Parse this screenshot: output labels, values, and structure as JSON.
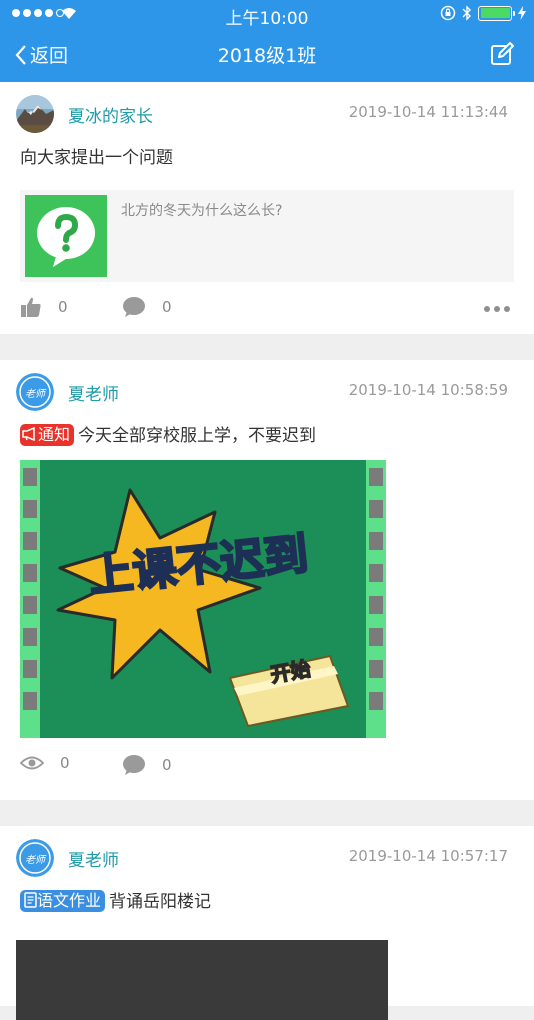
{
  "status_bar": {
    "time": "上午10:00"
  },
  "nav": {
    "back_label": "返回",
    "title": "2018级1班"
  },
  "posts": [
    {
      "author": "夏冰的家长",
      "date": "2019-10-14 11:13:44",
      "text": "向大家提出一个问题",
      "link_text": "北方的冬天为什么这么长?",
      "likes": "0",
      "comments": "0"
    },
    {
      "author": "夏老师",
      "date": "2019-10-14 10:58:59",
      "badge": "通知",
      "text": "今天全部穿校服上学，不要迟到",
      "image_title": "上课不迟到",
      "image_caption": "开始",
      "views": "0",
      "comments": "0"
    },
    {
      "author": "夏老师",
      "date": "2019-10-14 10:57:17",
      "badge": "语文作业",
      "text": "背诵岳阳楼记"
    }
  ],
  "avatar_teacher_label": "老师",
  "colors": {
    "primary": "#2e96e8",
    "name": "#1f9aa8",
    "notice_red": "#e8322a",
    "homework_blue": "#3b8fe0"
  }
}
